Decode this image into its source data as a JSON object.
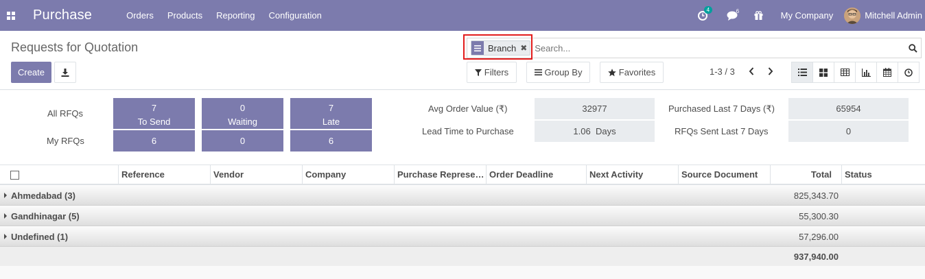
{
  "navbar": {
    "app_name": "Purchase",
    "menu": [
      "Orders",
      "Products",
      "Reporting",
      "Configuration"
    ],
    "activity_count": "4",
    "message_count": "6",
    "company": "My Company",
    "user": "Mitchell Admin",
    "icons": [
      "apps-icon",
      "clock-icon",
      "chat-icon",
      "gift-icon"
    ]
  },
  "control": {
    "title": "Requests for Quotation",
    "create_label": "Create",
    "search_facet": "Branch",
    "search_placeholder": "Search...",
    "filters_label": "Filters",
    "groupby_label": "Group By",
    "favorites_label": "Favorites",
    "pager": "1-3 / 3",
    "views": [
      "list-view-icon",
      "kanban-view-icon",
      "pivot-view-icon",
      "graph-view-icon",
      "calendar-view-icon",
      "activity-view-icon"
    ],
    "active_view": "list-view-icon"
  },
  "dashboard": {
    "all_rfqs_label": "All RFQs",
    "my_rfqs_label": "My RFQs",
    "tiles": [
      {
        "all": "7",
        "label": "To Send",
        "mine": "6"
      },
      {
        "all": "0",
        "label": "Waiting",
        "mine": "0"
      },
      {
        "all": "7",
        "label": "Late",
        "mine": "6"
      }
    ],
    "kpis": [
      {
        "label": "Avg Order Value (₹)",
        "value": "32977"
      },
      {
        "label": "Lead Time to Purchase",
        "value": "1.06  Days"
      },
      {
        "label": "Purchased Last 7 Days (₹)",
        "value": "65954"
      },
      {
        "label": "RFQs Sent Last 7 Days",
        "value": "0"
      }
    ]
  },
  "table": {
    "columns": [
      "Reference",
      "Vendor",
      "Company",
      "Purchase Representative",
      "Order Deadline",
      "Next Activity",
      "Source Document",
      "Total",
      "Status"
    ],
    "groups": [
      {
        "name": "Ahmedabad (3)",
        "total": "825,343.70"
      },
      {
        "name": "Gandhinagar (5)",
        "total": "55,300.30"
      },
      {
        "name": "Undefined (1)",
        "total": "57,296.00"
      }
    ],
    "grand_total": "937,940.00"
  },
  "colors": {
    "brand": "#7c7bad",
    "highlight": "#e21b1b",
    "badge": "#00a09d"
  }
}
